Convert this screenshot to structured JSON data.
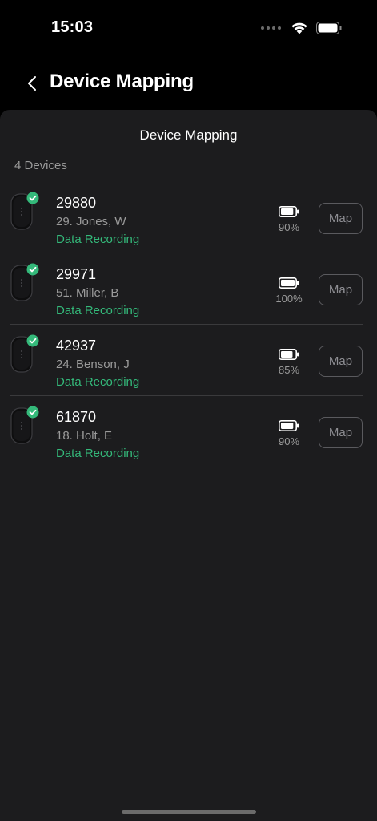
{
  "status_bar": {
    "time": "15:03"
  },
  "nav": {
    "title": "Device Mapping"
  },
  "sheet": {
    "title": "Device Mapping",
    "device_count": "4 Devices",
    "devices": [
      {
        "id": "29880",
        "player": "29. Jones, W",
        "status": "Data Recording",
        "battery": "90%",
        "battery_level": 0.9,
        "map_label": "Map"
      },
      {
        "id": "29971",
        "player": "51. Miller, B",
        "status": "Data Recording",
        "battery": "100%",
        "battery_level": 1.0,
        "map_label": "Map"
      },
      {
        "id": "42937",
        "player": "24. Benson, J",
        "status": "Data Recording",
        "battery": "85%",
        "battery_level": 0.85,
        "map_label": "Map"
      },
      {
        "id": "61870",
        "player": "18. Holt, E",
        "status": "Data Recording",
        "battery": "90%",
        "battery_level": 0.9,
        "map_label": "Map"
      }
    ]
  },
  "colors": {
    "background": "#000000",
    "sheet": "#1c1c1e",
    "status_green": "#34b97a",
    "secondary_text": "#9a9a9a"
  },
  "icons": {
    "back": "chevron-left-icon",
    "wifi": "wifi-icon",
    "battery": "battery-icon",
    "device": "device-tracker-icon",
    "check": "check-badge-icon"
  }
}
